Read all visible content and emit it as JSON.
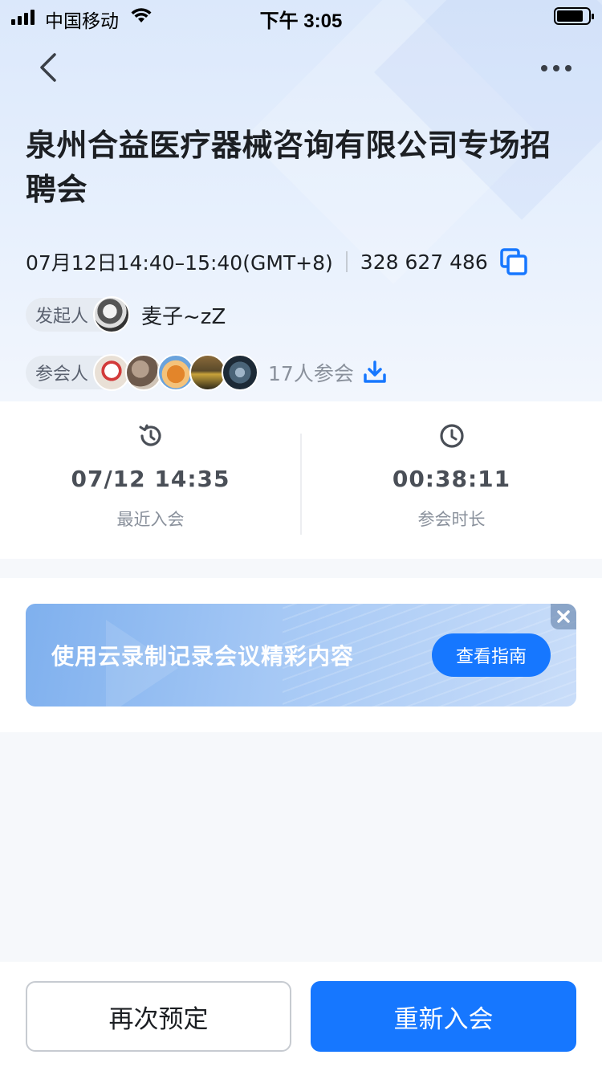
{
  "status_bar": {
    "carrier": "中国移动",
    "time": "下午 3:05"
  },
  "meeting": {
    "title": "泉州合益医疗器械咨询有限公司专场招聘会",
    "time_range": "07月12日14:40–15:40(GMT+8)",
    "meeting_id": "328 627 486",
    "organizer_label": "发起人",
    "organizer_name": "麦子~zZ",
    "attendees_label": "参会人",
    "attendees_count": "17人参会"
  },
  "stats": {
    "last_join_value": "07/12 14:35",
    "last_join_label": "最近入会",
    "duration_value": "00:38:11",
    "duration_label": "参会时长"
  },
  "banner": {
    "text": "使用云录制记录会议精彩内容",
    "button": "查看指南"
  },
  "actions": {
    "rebook": "再次预定",
    "rejoin": "重新入会"
  },
  "colors": {
    "accent": "#1677ff",
    "header_bg": "#dbe8fb",
    "stat_text": "#4a4f57"
  },
  "icons": {
    "back": "chevron-left-icon",
    "more": "more-dots-icon",
    "copy": "copy-icon",
    "download": "download-icon",
    "history": "history-clock-icon",
    "clock": "clock-icon",
    "close": "close-icon"
  }
}
